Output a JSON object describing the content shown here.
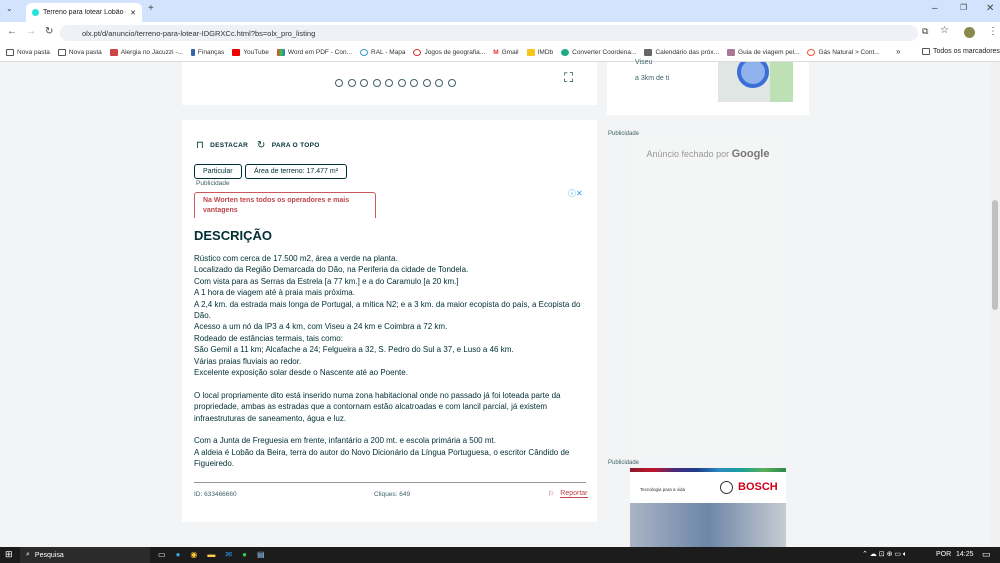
{
  "browser": {
    "tab_title": "Terreno para lotear Lobão da Beira",
    "url": "olx.pt/d/anuncio/terreno-para-lotear-IDGRXCc.html?bs=olx_pro_listing",
    "bookmarks": [
      "Nova pasta",
      "Nova pasta",
      "Alergia no Jacuzzi -...",
      "Finanças",
      "YouTube",
      "Word em PDF - Con...",
      "RAL - Mapa",
      "Jogos de geografia...",
      "Gmail",
      "IMDb",
      "Converter Coordena...",
      "Calendário das próx...",
      "Guia de viagem pel...",
      "Gás Natural > Cont..."
    ],
    "all_bookmarks": "Todos os marcadores"
  },
  "gallery": {
    "dots": 10,
    "active_index": 0
  },
  "actions": {
    "highlight": "DESTACAR",
    "to_top": "PARA O TOPO"
  },
  "chips": [
    "Particular",
    "Área de terreno: 17.477 m²"
  ],
  "ad_label": "Publicidade",
  "ad_text": "Na Worten tens todos os operadores e mais vantagens",
  "description": {
    "title": "DESCRIÇÃO",
    "lines1": [
      "Rústico com cerca de 17.500 m2, área a verde na planta.",
      "Localizado da Região Demarcada do Dão, na Periferia da cidade de Tondela.",
      "Com vista para as Serras da Estrela [a 77 km.] e a do Caramulo [a 20 km.]",
      "A 1 hora de viagem até à praia mais próxima.",
      "A 2,4 km. da estrada mais longa de Portugal, a mítica N2; e a 3 km. da maior ecopista do país, a Ecopista do Dão.",
      "Acesso a um nó da IP3 a 4 km, com Viseu a 24 km e Coimbra a 72 km.",
      "Rodeado de estâncias termais, tais como:",
      "São Gemil a 11 km; Alcafache a 24; Felgueira a 32, S. Pedro do Sul a 37, e Luso a 46 km.",
      "Várias praias fluviais ao redor.",
      "Excelente exposição solar desde o Nascente até ao Poente."
    ],
    "para2": "O local propriamente dito está inserido numa zona habitacional onde no passado já foi loteada parte da propriedade, ambas as estradas que a contornam estão alcatroadas e com lancil parcial, já existem infraestruturas de saneamento, água e luz.",
    "lines3": [
      "Com a Junta de Freguesia em frente, infantário a 200 mt. e escola primária a 500 mt.",
      "A aldeia é Lobão da Beira, terra do autor do Novo Dicionário da Língua Portuguesa, o escritor Cândido de Figueiredo."
    ]
  },
  "footer": {
    "id": "ID: 633466660",
    "clicks": "Cliques: 649",
    "report": "Reportar"
  },
  "sidebar": {
    "location_partial": "Viseu",
    "distance": "a 3km de ti",
    "ad_label": "Publicidade",
    "ad_closed": "Anúncio fechado por",
    "google": "Google",
    "ad2_label": "Publicidade",
    "bosch_tagline": "Tecnologia para a vida",
    "bosch_brand": "BOSCH"
  },
  "taskbar": {
    "search": "Pesquisa",
    "lang": "POR",
    "time": "14:25"
  }
}
